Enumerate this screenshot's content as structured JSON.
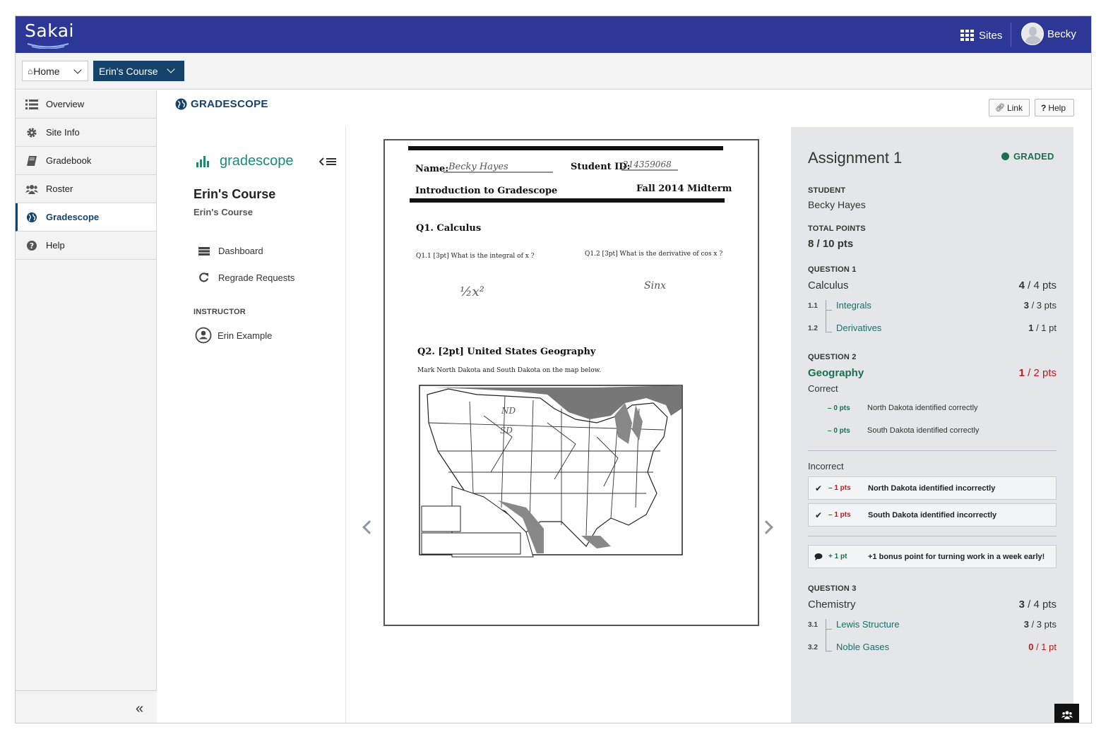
{
  "topbar": {
    "logo_text": "Sakai",
    "sites_label": "Sites",
    "user_name": "Becky",
    "color": "#2d3896"
  },
  "sitenav": {
    "home_label": "Home",
    "course_label": "Erin's Course"
  },
  "toolmenu": {
    "items": [
      {
        "label": "Overview",
        "icon": "list-icon"
      },
      {
        "label": "Site Info",
        "icon": "gear-icon"
      },
      {
        "label": "Gradebook",
        "icon": "book-icon"
      },
      {
        "label": "Roster",
        "icon": "users-icon"
      },
      {
        "label": "Gradescope",
        "icon": "globe-icon",
        "active": true
      },
      {
        "label": "Help",
        "icon": "question-icon"
      }
    ],
    "collapse_icon": "double-chevron-left-icon"
  },
  "tool": {
    "title": "GRADESCOPE",
    "link_button": "Link",
    "help_button": "Help"
  },
  "gradescope_nav": {
    "logo_text": "gradescope",
    "course_title": "Erin's Course",
    "course_subtitle": "Erin's Course",
    "links": [
      {
        "label": "Dashboard",
        "icon": "dashboard-icon"
      },
      {
        "label": "Regrade Requests",
        "icon": "redo-icon"
      }
    ],
    "instructor_heading": "INSTRUCTOR",
    "instructor_name": "Erin Example"
  },
  "submission": {
    "name_label": "Name:",
    "name_value": "Becky Hayes",
    "student_id_label": "Student ID:",
    "student_id_value": "214359068",
    "course_line": "Introduction to Gradescope",
    "exam_line": "Fall 2014 Midterm",
    "q1_heading": "Q1.  Calculus",
    "q1_1": "Q1.1  [3pt]  What is the integral of x ?",
    "q1_2": "Q1.2  [3pt]  What is the derivative of  cos x ?",
    "q1_1_answer": "½x²",
    "q1_2_answer": "Sinx",
    "q2_heading": "Q2.  [2pt] United States Geography",
    "q2_text": "Mark North Dakota and South Dakota on the map below.",
    "map_label_nd": "ND",
    "map_label_sd": "SD"
  },
  "grading": {
    "title": "Assignment 1",
    "status": "GRADED",
    "student_label": "STUDENT",
    "student_name": "Becky Hayes",
    "total_label": "TOTAL POINTS",
    "total_value": "8 / 10 pts",
    "q1": {
      "label": "QUESTION 1",
      "name": "Calculus",
      "score": "4",
      "max": " / 4 pts",
      "parts": [
        {
          "num": "1.1",
          "name": "Integrals",
          "score": "3",
          "max": " / 3 pts"
        },
        {
          "num": "1.2",
          "name": "Derivatives",
          "score": "1",
          "max": " / 1 pt"
        }
      ]
    },
    "q2": {
      "label": "QUESTION 2",
      "name": "Geography",
      "score": "1",
      "max": " / 2 pts",
      "correct_label": "Correct",
      "correct_items": [
        {
          "pts": "– 0 pts",
          "text": "North Dakota identified correctly"
        },
        {
          "pts": "– 0 pts",
          "text": "South Dakota identified correctly"
        }
      ],
      "incorrect_label": "Incorrect",
      "incorrect_items": [
        {
          "pts": "– 1 pts",
          "text": "North Dakota identified incorrectly",
          "applied": true
        },
        {
          "pts": "– 1 pts",
          "text": "South Dakota identified incorrectly",
          "applied": true
        }
      ],
      "comment": {
        "pts": "+ 1 pt",
        "text": "+1 bonus point for turning work in a week early!"
      }
    },
    "q3": {
      "label": "QUESTION 3",
      "name": "Chemistry",
      "score": "3",
      "max": " / 4 pts",
      "parts": [
        {
          "num": "3.1",
          "name": "Lewis Structure",
          "score": "3",
          "max": " / 3 pts"
        },
        {
          "num": "3.2",
          "name": "Noble Gases",
          "score": "0",
          "max": " / 1 pt"
        }
      ]
    }
  },
  "colors": {
    "brand": "#2d3896",
    "course": "#15436a",
    "gradescope": "#1b8a76",
    "graded": "#1b6f4d",
    "deduction": "#b51c1c"
  }
}
